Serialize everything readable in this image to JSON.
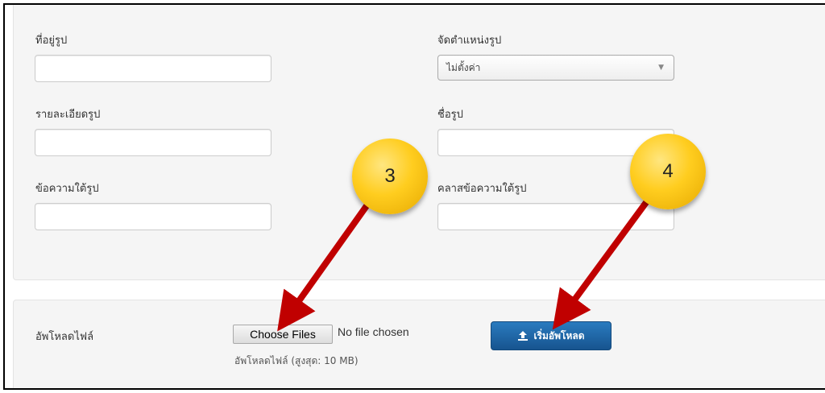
{
  "form": {
    "image_path_label": "ที่อยู่รูป",
    "alignment_label": "จัดตำแหน่งรูป",
    "alignment_selected": "ไม่ตั้งค่า",
    "image_desc_label": "รายละเอียดรูป",
    "image_name_label": "ชื่อรูป",
    "caption_label": "ข้อความใต้รูป",
    "caption_class_label": "คลาสข้อความใต้รูป"
  },
  "upload": {
    "label": "อัพโหลดไฟล์",
    "choose_files": "Choose Files",
    "no_file": "No file chosen",
    "helper": "อัพโหลดไฟล์ (สูงสุด: 10 MB)",
    "start_upload": "เริ่มอัพโหลด"
  },
  "annotations": {
    "badge_3": "3",
    "badge_4": "4",
    "arrow_color": "#c00000",
    "badge_color": "#ffcd1f"
  },
  "icons": {
    "upload": "upload-icon",
    "select_caret": "chevron-down-icon"
  }
}
